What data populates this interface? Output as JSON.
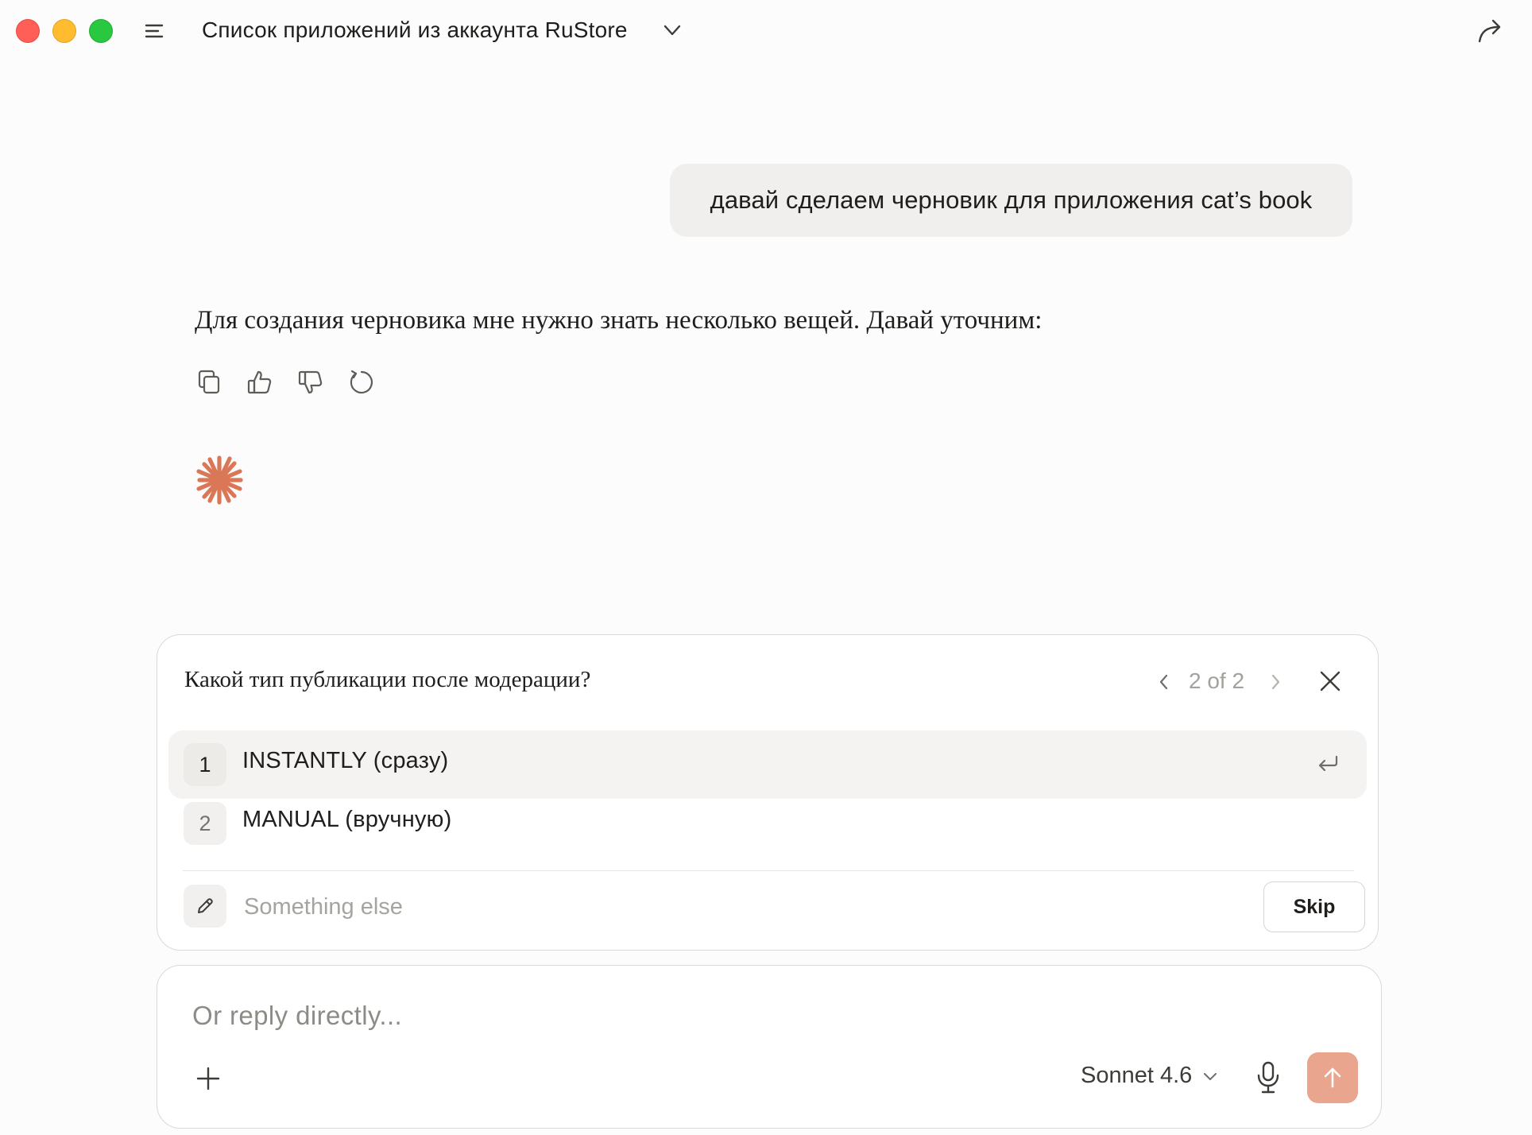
{
  "window": {
    "title": "Список приложений из аккаунта RuStore"
  },
  "icons": {
    "sidebar_toggle": "sidebar-toggle-icon",
    "title_menu": "chevron-down-icon",
    "share": "share-arrow-icon",
    "copy": "copy-icon",
    "thumbs_up": "thumbs-up-icon",
    "thumbs_down": "thumbs-down-icon",
    "retry": "retry-icon",
    "spark": "spark-icon",
    "enter": "enter-icon",
    "edit": "pencil-icon",
    "add": "plus-icon",
    "mic": "microphone-icon",
    "send": "arrow-up-icon"
  },
  "colors": {
    "accent": "#D97757",
    "send_button": "#E9A58D",
    "user_bubble": "#F0EFED",
    "traffic_red": "#FF5F57",
    "traffic_yellow": "#FEBC2E",
    "traffic_green": "#28C840"
  },
  "conversation": {
    "user_message": "давай сделаем черновик для приложения cat’s book",
    "assistant_message": "Для создания черновика мне нужно знать несколько вещей. Давай уточним:"
  },
  "question": {
    "text": "Какой тип публикации после модерации?",
    "pager": "2 of 2",
    "options": [
      {
        "number": "1",
        "label": "INSTANTLY (сразу)",
        "selected": true
      },
      {
        "number": "2",
        "label": "MANUAL (вручную)",
        "selected": false
      }
    ],
    "other_placeholder": "Something else",
    "skip_label": "Skip"
  },
  "composer": {
    "placeholder": "Or reply directly...",
    "model": "Sonnet 4.6"
  }
}
